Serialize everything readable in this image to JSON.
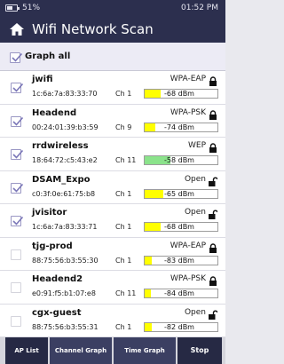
{
  "status": {
    "battery": "51%",
    "time": "01:52 PM"
  },
  "header": {
    "title": "Wifi Network Scan"
  },
  "graph_all": {
    "label": "Graph all",
    "checked": true
  },
  "networks": [
    {
      "ssid": "jwifi",
      "mac": "1c:6a:7a:83:33:70",
      "channel": "Ch 1",
      "signal": "-68 dBm",
      "security": "WPA-EAP",
      "locked": true,
      "checked": true,
      "level": 0.22,
      "color": "#ffff00"
    },
    {
      "ssid": "Headend",
      "mac": "00:24:01:39:b3:59",
      "channel": "Ch 9",
      "signal": "-74 dBm",
      "security": "WPA-PSK",
      "locked": true,
      "checked": true,
      "level": 0.15,
      "color": "#ffff00"
    },
    {
      "ssid": "rrdwireless",
      "mac": "18:64:72:c5:43:e2",
      "channel": "Ch 11",
      "signal": "-58 dBm",
      "security": "WEP",
      "locked": true,
      "checked": true,
      "level": 0.35,
      "color": "#8be38b"
    },
    {
      "ssid": "DSAM_Expo",
      "mac": "c0:3f:0e:61:75:b8",
      "channel": "Ch 1",
      "signal": "-65 dBm",
      "security": "Open",
      "locked": false,
      "checked": true,
      "level": 0.25,
      "color": "#ffff00"
    },
    {
      "ssid": "jvisitor",
      "mac": "1c:6a:7a:83:33:71",
      "channel": "Ch 1",
      "signal": "-68 dBm",
      "security": "Open",
      "locked": false,
      "checked": true,
      "level": 0.22,
      "color": "#ffff00"
    },
    {
      "ssid": "tjg-prod",
      "mac": "88:75:56:b3:55:30",
      "channel": "Ch 1",
      "signal": "-83 dBm",
      "security": "WPA-EAP",
      "locked": true,
      "checked": false,
      "level": 0.1,
      "color": "#ffff00"
    },
    {
      "ssid": "Headend2",
      "mac": "e0:91:f5:b1:07:e8",
      "channel": "Ch 11",
      "signal": "-84 dBm",
      "security": "WPA-PSK",
      "locked": true,
      "checked": false,
      "level": 0.08,
      "color": "#ffff00"
    },
    {
      "ssid": "cgx-guest",
      "mac": "88:75:56:b3:55:31",
      "channel": "Ch 1",
      "signal": "-82 dBm",
      "security": "Open",
      "locked": false,
      "checked": false,
      "level": 0.1,
      "color": "#ffff00"
    }
  ],
  "tabs": [
    {
      "label": "AP List",
      "active": true
    },
    {
      "label": "Channel Graph",
      "active": false
    },
    {
      "label": "Time Graph",
      "active": false
    },
    {
      "label": "Stop",
      "active": false
    }
  ],
  "colors": {
    "header_bg": "#2c2f4e",
    "checkbox_border": "#9a97c4",
    "signal_strong": "#8be38b",
    "signal_weak": "#ffff00"
  }
}
